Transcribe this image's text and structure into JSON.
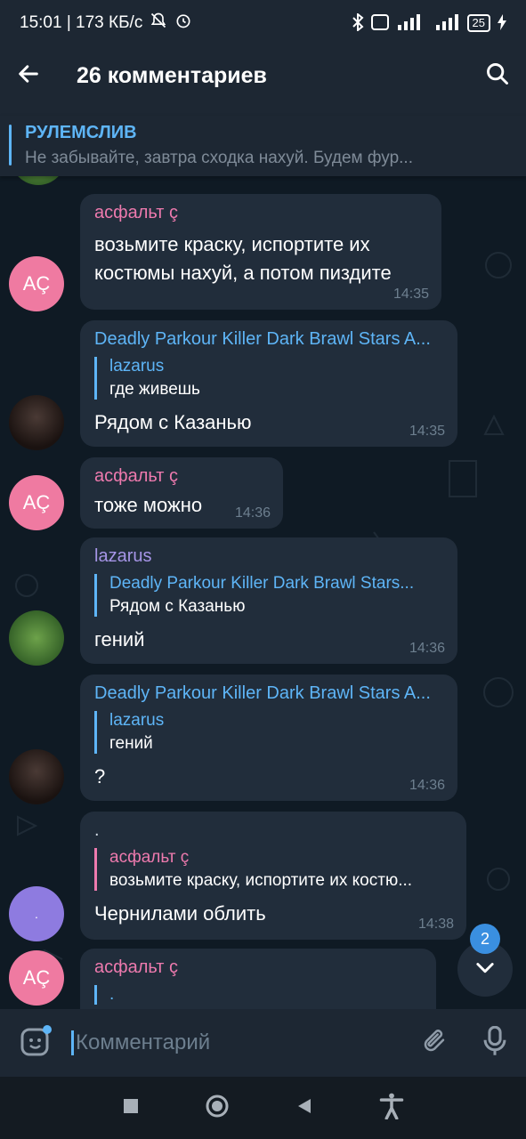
{
  "status": {
    "time_speed": "15:01 | 173 КБ/с",
    "battery": "25"
  },
  "header": {
    "title": "26 комментариев"
  },
  "pinned": {
    "name": "РУЛЕМСЛИВ",
    "text": "Не забывайте, завтра сходка нахуй. Будем фур..."
  },
  "messages": [
    {
      "sender": "асфальт ç",
      "text": "возьмите краску, испортите их костюмы нахуй, а потом пиздите",
      "time": "14:35",
      "avatar": "AÇ"
    },
    {
      "sender": "Deadly Parkour Killer Dark Brawl Stars A...",
      "quote_name": "lazarus",
      "quote_text": "где живешь",
      "text": "Рядом с Казанью",
      "time": "14:35"
    },
    {
      "sender": "асфальт ç",
      "text": "тоже можно",
      "time": "14:36",
      "avatar": "AÇ"
    },
    {
      "sender": "lazarus",
      "quote_name": "Deadly Parkour Killer Dark Brawl Stars...",
      "quote_text": "Рядом с Казанью",
      "text": "гений",
      "time": "14:36"
    },
    {
      "sender": "Deadly Parkour Killer Dark Brawl Stars A...",
      "quote_name": "lazarus",
      "quote_text": "гений",
      "text": "?",
      "time": "14:36"
    },
    {
      "sender": ".",
      "quote_name": "асфальт ç",
      "quote_text": "возьмите краску, испортите их костю...",
      "text": "Чернилами облить",
      "time": "14:38",
      "avatar": "."
    },
    {
      "sender": "асфальт ç",
      "quote_name": ".",
      "avatar": "AÇ"
    }
  ],
  "scroll_badge": "2",
  "composer": {
    "placeholder": "Комментарий"
  }
}
